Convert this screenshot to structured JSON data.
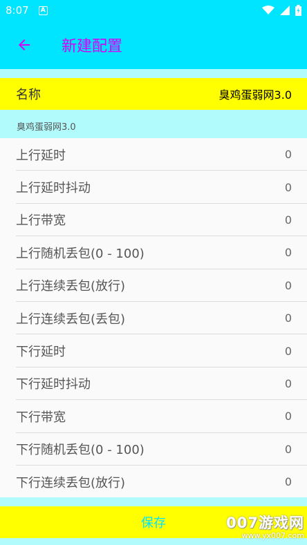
{
  "status": {
    "time": "8:07",
    "notification_letter": "A"
  },
  "appbar": {
    "title": "新建配置"
  },
  "name": {
    "label": "名称",
    "value": "臭鸡蛋弱网3.0",
    "hint": "臭鸡蛋弱网3.0"
  },
  "settings": [
    {
      "label": "上行延时",
      "value": "0"
    },
    {
      "label": "上行延时抖动",
      "value": "0"
    },
    {
      "label": "上行带宽",
      "value": "0"
    },
    {
      "label": "上行随机丢包(0 - 100)",
      "value": "0"
    },
    {
      "label": "上行连续丢包(放行)",
      "value": "0"
    },
    {
      "label": "上行连续丢包(丢包)",
      "value": "0"
    },
    {
      "label": "下行延时",
      "value": "0"
    },
    {
      "label": "下行延时抖动",
      "value": "0"
    },
    {
      "label": "下行带宽",
      "value": "0"
    },
    {
      "label": "下行随机丢包(0 - 100)",
      "value": "0"
    },
    {
      "label": "下行连续丢包(放行)",
      "value": "0"
    }
  ],
  "save_label": "保存",
  "watermark": {
    "text": "007游戏网",
    "url": "www.yx007.com"
  },
  "colors": {
    "accent": "#00e5ff",
    "title": "#d500f9",
    "highlight": "#ffff00"
  }
}
